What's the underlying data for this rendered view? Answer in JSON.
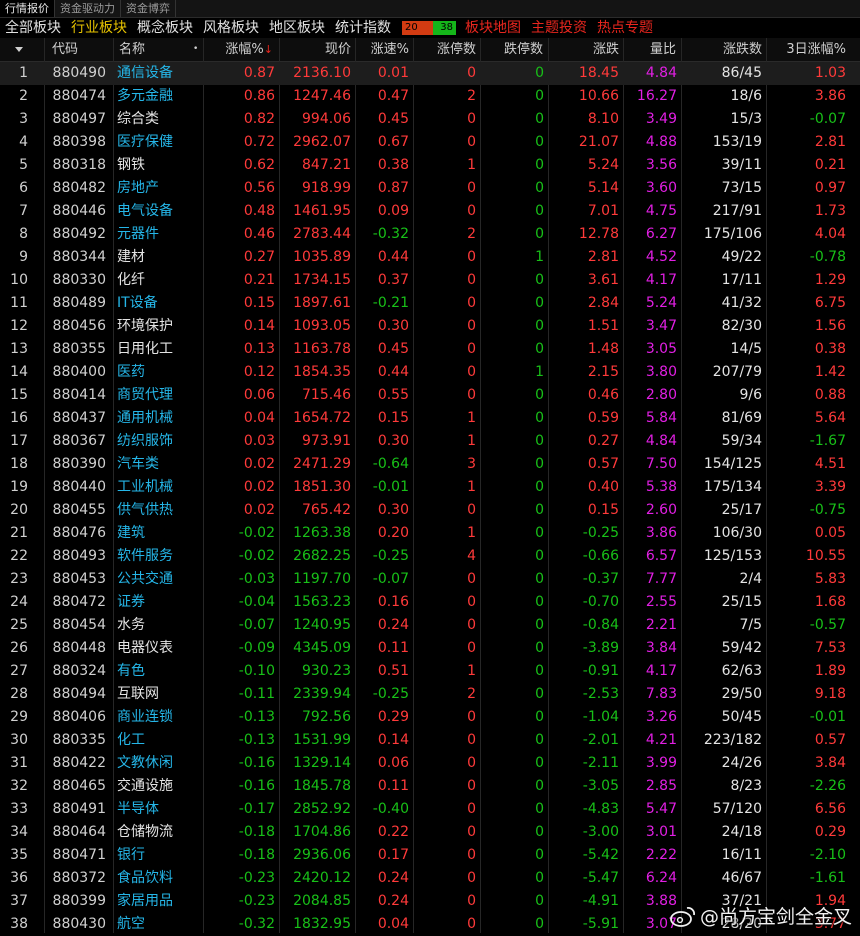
{
  "top_tabs": [
    "行情报价",
    "资金驱动力",
    "资金博弈"
  ],
  "categories": {
    "all": "全部板块",
    "industry": "行业板块",
    "concept": "概念板块",
    "style": "风格板块",
    "region": "地区板块",
    "stats": "统计指数",
    "adv_up": "20",
    "adv_down": "38",
    "map": "板块地图",
    "theme": "主题投资",
    "hot": "热点专题"
  },
  "headers": {
    "code": "代码",
    "name": "名称",
    "pct": "涨幅%",
    "price": "现价",
    "speed": "涨速%",
    "limit_up": "涨停数",
    "limit_down": "跌停数",
    "change": "涨跌",
    "ratio": "量比",
    "updown": "涨跌数",
    "pct3d": "3日涨幅%"
  },
  "colors": {
    "up": "#ff3a3a",
    "down": "#18c018",
    "name": "#25b6e8",
    "ratio": "#e11fe3",
    "active_tab": "#e6c200"
  },
  "rows": [
    {
      "idx": "1",
      "code": "880490",
      "name": "通信设备",
      "pct": "0.87",
      "price": "2136.10",
      "speed": "0.01",
      "limit_up": "0",
      "limit_down": "0",
      "change": "18.45",
      "ratio": "4.84",
      "updown": "86/45",
      "pct3d": "1.03"
    },
    {
      "idx": "2",
      "code": "880474",
      "name": "多元金融",
      "pct": "0.86",
      "price": "1247.46",
      "speed": "0.47",
      "limit_up": "2",
      "limit_down": "0",
      "change": "10.66",
      "ratio": "16.27",
      "updown": "18/6",
      "pct3d": "3.86"
    },
    {
      "idx": "3",
      "code": "880497",
      "name": "综合类",
      "pct": "0.82",
      "price": "994.06",
      "speed": "0.45",
      "limit_up": "0",
      "limit_down": "0",
      "change": "8.10",
      "ratio": "3.49",
      "updown": "15/3",
      "pct3d": "-0.07"
    },
    {
      "idx": "4",
      "code": "880398",
      "name": "医疗保健",
      "pct": "0.72",
      "price": "2962.07",
      "speed": "0.67",
      "limit_up": "0",
      "limit_down": "0",
      "change": "21.07",
      "ratio": "4.88",
      "updown": "153/19",
      "pct3d": "2.81"
    },
    {
      "idx": "5",
      "code": "880318",
      "name": "钢铁",
      "pct": "0.62",
      "price": "847.21",
      "speed": "0.38",
      "limit_up": "1",
      "limit_down": "0",
      "change": "5.24",
      "ratio": "3.56",
      "updown": "39/11",
      "pct3d": "0.21"
    },
    {
      "idx": "6",
      "code": "880482",
      "name": "房地产",
      "pct": "0.56",
      "price": "918.99",
      "speed": "0.87",
      "limit_up": "0",
      "limit_down": "0",
      "change": "5.14",
      "ratio": "3.60",
      "updown": "73/15",
      "pct3d": "0.97"
    },
    {
      "idx": "7",
      "code": "880446",
      "name": "电气设备",
      "pct": "0.48",
      "price": "1461.95",
      "speed": "0.09",
      "limit_up": "0",
      "limit_down": "0",
      "change": "7.01",
      "ratio": "4.75",
      "updown": "217/91",
      "pct3d": "1.73"
    },
    {
      "idx": "8",
      "code": "880492",
      "name": "元器件",
      "pct": "0.46",
      "price": "2783.44",
      "speed": "-0.32",
      "limit_up": "2",
      "limit_down": "0",
      "change": "12.78",
      "ratio": "6.27",
      "updown": "175/106",
      "pct3d": "4.04"
    },
    {
      "idx": "9",
      "code": "880344",
      "name": "建材",
      "pct": "0.27",
      "price": "1035.89",
      "speed": "0.44",
      "limit_up": "0",
      "limit_down": "1",
      "change": "2.81",
      "ratio": "4.52",
      "updown": "49/22",
      "pct3d": "-0.78"
    },
    {
      "idx": "10",
      "code": "880330",
      "name": "化纤",
      "pct": "0.21",
      "price": "1734.15",
      "speed": "0.37",
      "limit_up": "0",
      "limit_down": "0",
      "change": "3.61",
      "ratio": "4.17",
      "updown": "17/11",
      "pct3d": "1.29"
    },
    {
      "idx": "11",
      "code": "880489",
      "name": "IT设备",
      "pct": "0.15",
      "price": "1897.61",
      "speed": "-0.21",
      "limit_up": "0",
      "limit_down": "0",
      "change": "2.84",
      "ratio": "5.24",
      "updown": "41/32",
      "pct3d": "6.75"
    },
    {
      "idx": "12",
      "code": "880456",
      "name": "环境保护",
      "pct": "0.14",
      "price": "1093.05",
      "speed": "0.30",
      "limit_up": "0",
      "limit_down": "0",
      "change": "1.51",
      "ratio": "3.47",
      "updown": "82/30",
      "pct3d": "1.56"
    },
    {
      "idx": "13",
      "code": "880355",
      "name": "日用化工",
      "pct": "0.13",
      "price": "1163.78",
      "speed": "0.45",
      "limit_up": "0",
      "limit_down": "0",
      "change": "1.48",
      "ratio": "3.05",
      "updown": "14/5",
      "pct3d": "0.38"
    },
    {
      "idx": "14",
      "code": "880400",
      "name": "医药",
      "pct": "0.12",
      "price": "1854.35",
      "speed": "0.44",
      "limit_up": "0",
      "limit_down": "1",
      "change": "2.15",
      "ratio": "3.80",
      "updown": "207/79",
      "pct3d": "1.42"
    },
    {
      "idx": "15",
      "code": "880414",
      "name": "商贸代理",
      "pct": "0.06",
      "price": "715.46",
      "speed": "0.55",
      "limit_up": "0",
      "limit_down": "0",
      "change": "0.46",
      "ratio": "2.80",
      "updown": "9/6",
      "pct3d": "0.88"
    },
    {
      "idx": "16",
      "code": "880437",
      "name": "通用机械",
      "pct": "0.04",
      "price": "1654.72",
      "speed": "0.15",
      "limit_up": "1",
      "limit_down": "0",
      "change": "0.59",
      "ratio": "5.84",
      "updown": "81/69",
      "pct3d": "5.64"
    },
    {
      "idx": "17",
      "code": "880367",
      "name": "纺织服饰",
      "pct": "0.03",
      "price": "973.91",
      "speed": "0.30",
      "limit_up": "1",
      "limit_down": "0",
      "change": "0.27",
      "ratio": "4.84",
      "updown": "59/34",
      "pct3d": "-1.67"
    },
    {
      "idx": "18",
      "code": "880390",
      "name": "汽车类",
      "pct": "0.02",
      "price": "2471.29",
      "speed": "-0.64",
      "limit_up": "3",
      "limit_down": "0",
      "change": "0.57",
      "ratio": "7.50",
      "updown": "154/125",
      "pct3d": "4.51"
    },
    {
      "idx": "19",
      "code": "880440",
      "name": "工业机械",
      "pct": "0.02",
      "price": "1851.30",
      "speed": "-0.01",
      "limit_up": "1",
      "limit_down": "0",
      "change": "0.40",
      "ratio": "5.38",
      "updown": "175/134",
      "pct3d": "3.39"
    },
    {
      "idx": "20",
      "code": "880455",
      "name": "供气供热",
      "pct": "0.02",
      "price": "765.42",
      "speed": "0.30",
      "limit_up": "0",
      "limit_down": "0",
      "change": "0.15",
      "ratio": "2.60",
      "updown": "25/17",
      "pct3d": "-0.75"
    },
    {
      "idx": "21",
      "code": "880476",
      "name": "建筑",
      "pct": "-0.02",
      "price": "1263.38",
      "speed": "0.20",
      "limit_up": "1",
      "limit_down": "0",
      "change": "-0.25",
      "ratio": "3.86",
      "updown": "106/30",
      "pct3d": "0.05"
    },
    {
      "idx": "22",
      "code": "880493",
      "name": "软件服务",
      "pct": "-0.02",
      "price": "2682.25",
      "speed": "-0.25",
      "limit_up": "4",
      "limit_down": "0",
      "change": "-0.66",
      "ratio": "6.57",
      "updown": "125/153",
      "pct3d": "10.55"
    },
    {
      "idx": "23",
      "code": "880453",
      "name": "公共交通",
      "pct": "-0.03",
      "price": "1197.70",
      "speed": "-0.07",
      "limit_up": "0",
      "limit_down": "0",
      "change": "-0.37",
      "ratio": "7.77",
      "updown": "2/4",
      "pct3d": "5.83"
    },
    {
      "idx": "24",
      "code": "880472",
      "name": "证券",
      "pct": "-0.04",
      "price": "1563.23",
      "speed": "0.16",
      "limit_up": "0",
      "limit_down": "0",
      "change": "-0.70",
      "ratio": "2.55",
      "updown": "25/15",
      "pct3d": "1.68"
    },
    {
      "idx": "25",
      "code": "880454",
      "name": "水务",
      "pct": "-0.07",
      "price": "1240.95",
      "speed": "0.24",
      "limit_up": "0",
      "limit_down": "0",
      "change": "-0.84",
      "ratio": "2.21",
      "updown": "7/5",
      "pct3d": "-0.57"
    },
    {
      "idx": "26",
      "code": "880448",
      "name": "电器仪表",
      "pct": "-0.09",
      "price": "4345.09",
      "speed": "0.11",
      "limit_up": "0",
      "limit_down": "0",
      "change": "-3.89",
      "ratio": "3.84",
      "updown": "59/42",
      "pct3d": "7.53"
    },
    {
      "idx": "27",
      "code": "880324",
      "name": "有色",
      "pct": "-0.10",
      "price": "930.23",
      "speed": "0.51",
      "limit_up": "1",
      "limit_down": "0",
      "change": "-0.91",
      "ratio": "4.17",
      "updown": "62/63",
      "pct3d": "1.89"
    },
    {
      "idx": "28",
      "code": "880494",
      "name": "互联网",
      "pct": "-0.11",
      "price": "2339.94",
      "speed": "-0.25",
      "limit_up": "2",
      "limit_down": "0",
      "change": "-2.53",
      "ratio": "7.83",
      "updown": "29/50",
      "pct3d": "9.18"
    },
    {
      "idx": "29",
      "code": "880406",
      "name": "商业连锁",
      "pct": "-0.13",
      "price": "792.56",
      "speed": "0.29",
      "limit_up": "0",
      "limit_down": "0",
      "change": "-1.04",
      "ratio": "3.26",
      "updown": "50/45",
      "pct3d": "-0.01"
    },
    {
      "idx": "30",
      "code": "880335",
      "name": "化工",
      "pct": "-0.13",
      "price": "1531.99",
      "speed": "0.14",
      "limit_up": "0",
      "limit_down": "0",
      "change": "-2.01",
      "ratio": "4.21",
      "updown": "223/182",
      "pct3d": "0.57"
    },
    {
      "idx": "31",
      "code": "880422",
      "name": "文教休闲",
      "pct": "-0.16",
      "price": "1329.14",
      "speed": "0.06",
      "limit_up": "0",
      "limit_down": "0",
      "change": "-2.11",
      "ratio": "3.99",
      "updown": "24/26",
      "pct3d": "3.84"
    },
    {
      "idx": "32",
      "code": "880465",
      "name": "交通设施",
      "pct": "-0.16",
      "price": "1845.78",
      "speed": "0.11",
      "limit_up": "0",
      "limit_down": "0",
      "change": "-3.05",
      "ratio": "2.85",
      "updown": "8/23",
      "pct3d": "-2.26"
    },
    {
      "idx": "33",
      "code": "880491",
      "name": "半导体",
      "pct": "-0.17",
      "price": "2852.92",
      "speed": "-0.40",
      "limit_up": "0",
      "limit_down": "0",
      "change": "-4.83",
      "ratio": "5.47",
      "updown": "57/120",
      "pct3d": "6.56"
    },
    {
      "idx": "34",
      "code": "880464",
      "name": "仓储物流",
      "pct": "-0.18",
      "price": "1704.86",
      "speed": "0.22",
      "limit_up": "0",
      "limit_down": "0",
      "change": "-3.00",
      "ratio": "3.01",
      "updown": "24/18",
      "pct3d": "0.29"
    },
    {
      "idx": "35",
      "code": "880471",
      "name": "银行",
      "pct": "-0.18",
      "price": "2936.06",
      "speed": "0.17",
      "limit_up": "0",
      "limit_down": "0",
      "change": "-5.42",
      "ratio": "2.22",
      "updown": "16/11",
      "pct3d": "-2.10"
    },
    {
      "idx": "36",
      "code": "880372",
      "name": "食品饮料",
      "pct": "-0.23",
      "price": "2420.12",
      "speed": "0.24",
      "limit_up": "0",
      "limit_down": "0",
      "change": "-5.47",
      "ratio": "6.24",
      "updown": "46/67",
      "pct3d": "-1.61"
    },
    {
      "idx": "37",
      "code": "880399",
      "name": "家居用品",
      "pct": "-0.23",
      "price": "2084.85",
      "speed": "0.24",
      "limit_up": "0",
      "limit_down": "0",
      "change": "-4.91",
      "ratio": "3.88",
      "updown": "37/21",
      "pct3d": "1.94"
    },
    {
      "idx": "38",
      "code": "880430",
      "name": "航空",
      "pct": "-0.32",
      "price": "1832.95",
      "speed": "0.04",
      "limit_up": "0",
      "limit_down": "0",
      "change": "-5.91",
      "ratio": "3.07",
      "updown": "28/20",
      "pct3d": "3.77"
    }
  ],
  "watermark": "@尚方宝剑全金叉"
}
